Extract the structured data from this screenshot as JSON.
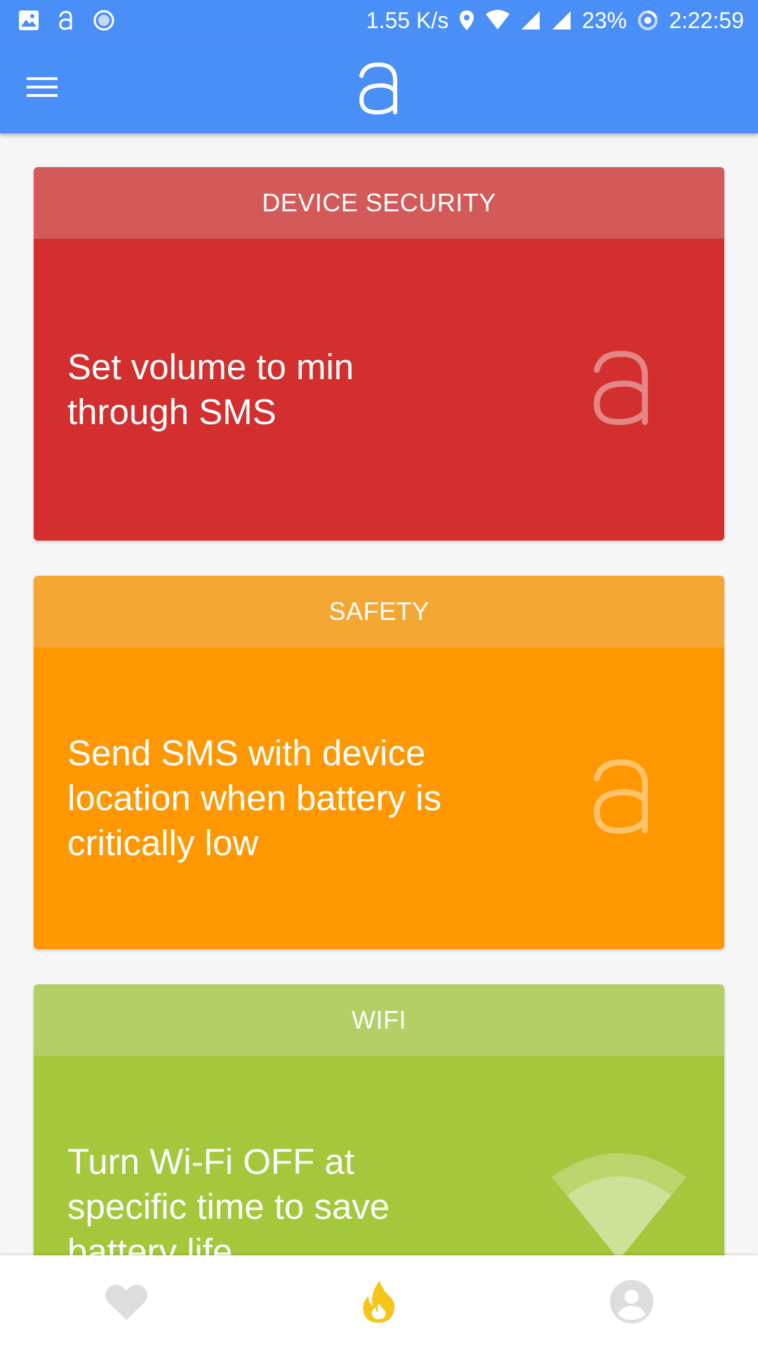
{
  "status_bar": {
    "speed": "1.55 K/s",
    "battery": "23%",
    "time": "2:22:59"
  },
  "app_bar": {
    "logo_text": "a"
  },
  "cards": [
    {
      "category": "DEVICE SECURITY",
      "title": "Set volume to min through SMS",
      "header_color": "#d45a5a",
      "body_color": "#d32f2f",
      "icon": "app-logo-icon"
    },
    {
      "category": "SAFETY",
      "title": "Send SMS with device location when battery is critically low",
      "header_color": "#f5a733",
      "body_color": "#ff9800",
      "icon": "app-logo-icon"
    },
    {
      "category": "WIFI",
      "title": "Turn Wi-Fi OFF at specific time to save battery life",
      "header_color": "#b4cf65",
      "body_color": "#a4c73b",
      "icon": "wifi-icon"
    }
  ],
  "bottom_nav": {
    "items": [
      {
        "name": "favorites",
        "icon": "heart-icon",
        "color": "#dddddd"
      },
      {
        "name": "hot",
        "icon": "flame-icon",
        "color": "#f5c518"
      },
      {
        "name": "profile",
        "icon": "account-icon",
        "color": "#dddddd"
      }
    ]
  }
}
